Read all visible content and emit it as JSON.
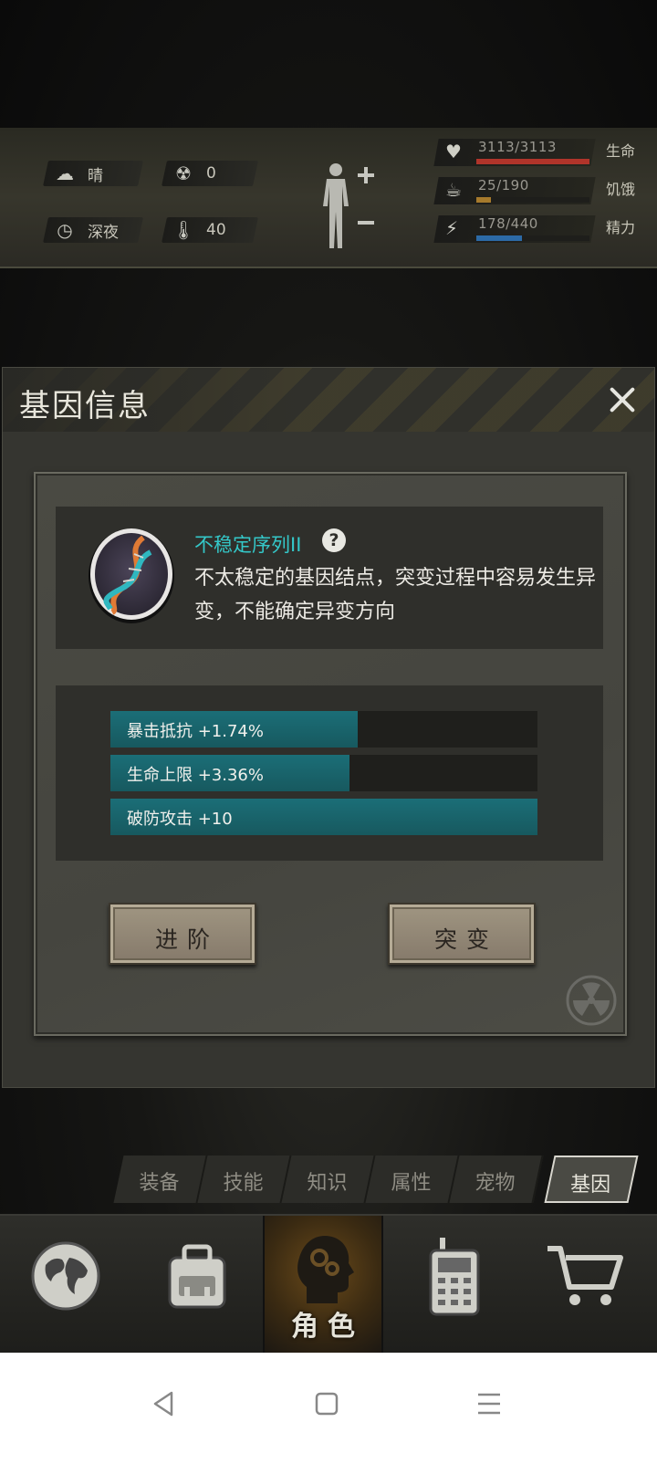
{
  "hud": {
    "weather": "晴",
    "radiation": "0",
    "time_of_day": "深夜",
    "temperature": "40",
    "stats": [
      {
        "icon": "heart-icon",
        "value": "3113/3113",
        "name": "生命",
        "fill": 1.0,
        "color": "#b0342a"
      },
      {
        "icon": "food-icon",
        "value": "25/190",
        "name": "饥饿",
        "fill": 0.13,
        "color": "#a67a2c"
      },
      {
        "icon": "energy-icon",
        "value": "178/440",
        "name": "精力",
        "fill": 0.4,
        "color": "#2c6aa6"
      }
    ]
  },
  "dialog": {
    "title": "基因信息",
    "gene": {
      "name": "不稳定序列II",
      "help": "?",
      "description": "不太稳定的基因结点，突变过程中容易发生异变，不能确定异变方向"
    },
    "bonuses": [
      {
        "label": "暴击抵抗 +1.74%",
        "fill": 0.58
      },
      {
        "label": "生命上限 +3.36%",
        "fill": 0.56
      },
      {
        "label": "破防攻击 +10",
        "fill": 1.0
      }
    ],
    "advance_button": "进阶",
    "mutate_button": "突变"
  },
  "tabs": [
    "装备",
    "技能",
    "知识",
    "属性",
    "宠物",
    "基因"
  ],
  "active_tab": "基因",
  "bottom_nav": {
    "items": [
      "map",
      "backpack",
      "character",
      "radio",
      "shop"
    ],
    "character_label": "角色"
  },
  "colors": {
    "accent_teal": "#34c8c9",
    "bar_teal": "#1b6e77"
  }
}
